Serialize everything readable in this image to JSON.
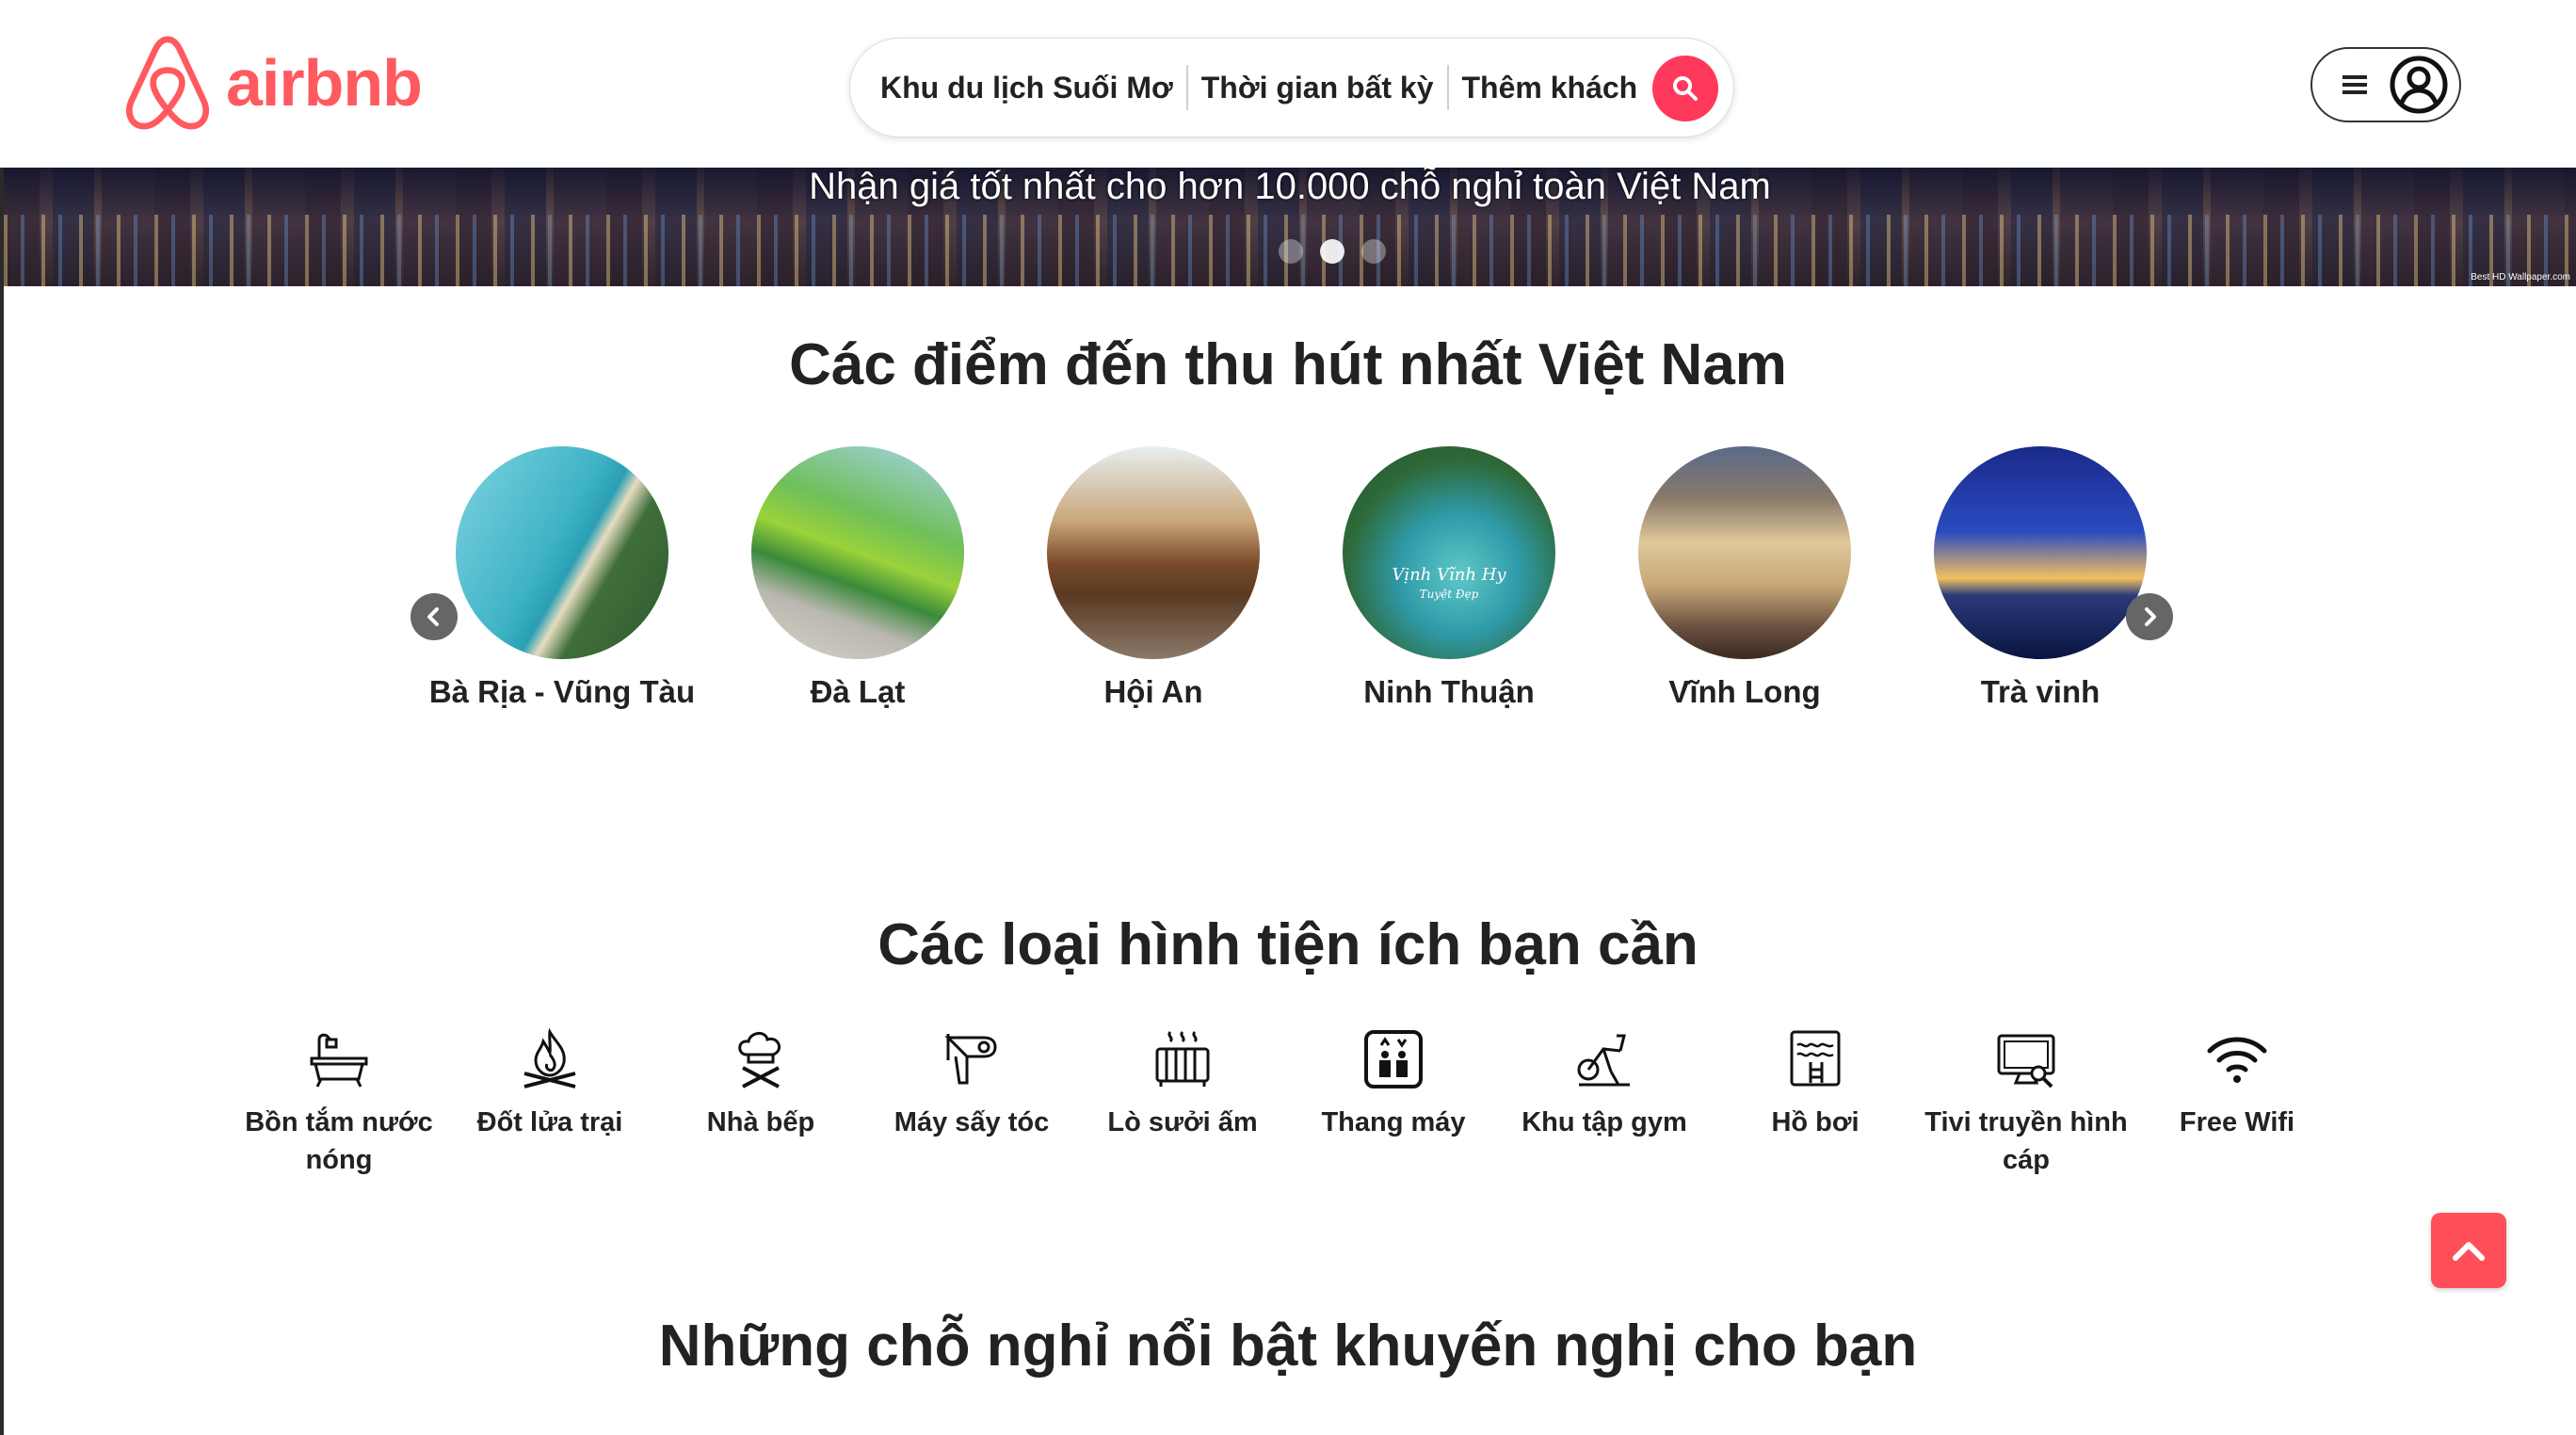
{
  "brand": {
    "name": "airbnb",
    "color": "#ff5a5f"
  },
  "search": {
    "location": "Khu du lịch Suối Mơ",
    "time": "Thời gian bất kỳ",
    "guests": "Thêm khách",
    "button_color": "#ff385c"
  },
  "banner": {
    "text": "Nhận giá tốt nhất cho hơn 10.000 chỗ nghỉ toàn Việt Nam",
    "credit": "Best HD Wallpaper.com",
    "slides": 3,
    "active_slide": 1
  },
  "destinations": {
    "title": "Các điểm đến thu hút nhất Việt Nam",
    "items": [
      {
        "name": "Bà Rịa - Vũng Tàu",
        "image": "beach-coastline"
      },
      {
        "name": "Đà Lạt",
        "image": "flower-building"
      },
      {
        "name": "Hội An",
        "image": "covered-bridge"
      },
      {
        "name": "Ninh Thuận",
        "image": "bay-islands",
        "image_caption": "Vịnh Vĩnh Hy",
        "image_subcaption": "Tuyệt Đẹp"
      },
      {
        "name": "Vĩnh Long",
        "image": "hotel-building"
      },
      {
        "name": "Trà vinh",
        "image": "bridge-night"
      }
    ]
  },
  "amenities": {
    "title": "Các loại hình tiện ích bạn cần",
    "items": [
      {
        "label": "Bồn tắm nước nóng",
        "icon": "bathtub-icon"
      },
      {
        "label": "Đốt lửa trại",
        "icon": "campfire-icon"
      },
      {
        "label": "Nhà bếp",
        "icon": "chef-icon"
      },
      {
        "label": "Máy sấy tóc",
        "icon": "hair-dryer-icon"
      },
      {
        "label": "Lò sưởi ấm",
        "icon": "heater-icon"
      },
      {
        "label": "Thang máy",
        "icon": "elevator-icon"
      },
      {
        "label": "Khu tập gym",
        "icon": "exercise-bike-icon"
      },
      {
        "label": "Hồ bơi",
        "icon": "pool-icon"
      },
      {
        "label": "Tivi truyền hình cáp",
        "icon": "tv-icon"
      },
      {
        "label": "Free Wifi",
        "icon": "wifi-icon"
      }
    ]
  },
  "featured": {
    "title": "Những chỗ nghỉ nổi bật khuyến nghị cho bạn"
  },
  "accent_color": "#ff4f5a"
}
